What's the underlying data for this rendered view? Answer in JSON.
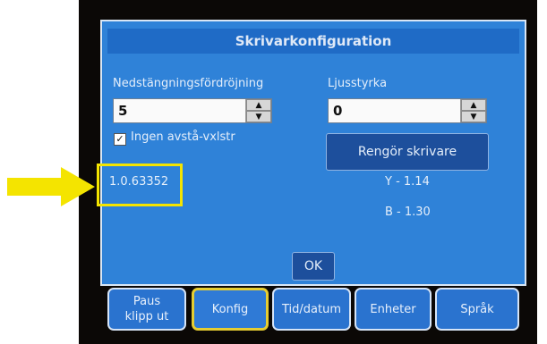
{
  "dialog": {
    "title": "Skrivarkonfiguration",
    "shutdown_delay_label": "Nedstängningsfördröjning",
    "shutdown_delay_value": "5",
    "brightness_label": "Ljusstyrka",
    "brightness_value": "0",
    "no_cut_checkbox_label": "Ingen avstå-vxlstr",
    "no_cut_checked": true,
    "clean_printer_button": "Rengör skrivare",
    "firmware_version": "1.0.63352",
    "y_version": "Y - 1.14",
    "b_version": "B - 1.30",
    "ok_button": "OK"
  },
  "tabs": [
    {
      "label_line1": "Paus",
      "label_line2": "klipp ut"
    },
    {
      "label": "Konfig",
      "active": true
    },
    {
      "label": "Tid/datum"
    },
    {
      "label": "Enheter"
    },
    {
      "label": "Språk"
    }
  ],
  "icons": {
    "spin_up": "arrow-up-icon",
    "spin_down": "arrow-down-icon",
    "pointer": "yellow-arrow-icon"
  },
  "colors": {
    "screen": "#2f82d8",
    "highlight": "#f4e400",
    "button": "#1d4f9c"
  }
}
